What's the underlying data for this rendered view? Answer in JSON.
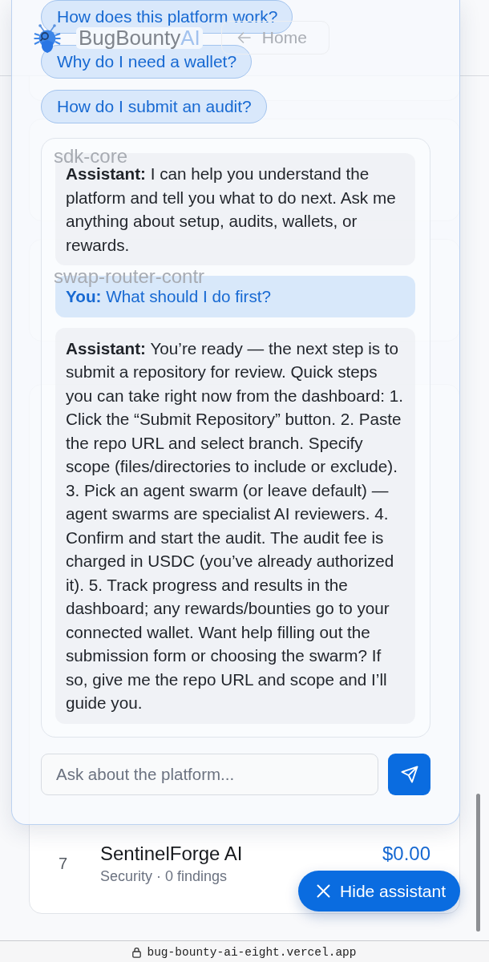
{
  "header": {
    "brand": "BugBounty",
    "brand_suffix": "AI",
    "home_label": "Home"
  },
  "repo_cards": [
    {
      "title": "sdk-core"
    },
    {
      "title": "swap-router-contr"
    }
  ],
  "leaderboard": {
    "rows": [
      {
        "rank": "7",
        "name": "SentinelForge AI",
        "meta": "Security · 0 findings",
        "amount": "$0.00"
      }
    ]
  },
  "assistant": {
    "suggestions": [
      "How does this platform work?",
      "Why do I need a wallet?",
      "How do I submit an audit?"
    ],
    "messages": [
      {
        "kind": "assistant",
        "text": "**Assistant:** I can help you understand the platform and tell you what to do next. Ask me anything about setup, audits, wallets, or rewards."
      },
      {
        "kind": "user",
        "text": "**You:** What should I do first?"
      },
      {
        "kind": "assistant",
        "text": "**Assistant:** You’re ready — the next step is to submit a repository for review. Quick steps you can take right now from the dashboard: 1. Click the “Submit Repository” button. 2. Paste the repo URL and select branch. Specify scope (files/directories to include or exclude). 3. Pick an agent swarm (or leave default) — agent swarms are specialist AI reviewers. 4. Confirm and start the audit. The audit fee is charged in USDC (you’ve already authorized it). 5. Track progress and results in the dashboard; any rewards/bounties go to your connected wallet. Want help filling out the submission form or choosing the swarm? If so, give me the repo URL and scope and I’ll guide you."
      }
    ],
    "input": {
      "placeholder": "Ask about the platform..."
    },
    "toggle_button": {
      "label": "Hide assistant"
    }
  },
  "browser": {
    "url": "bug-bounty-ai-eight.vercel.app"
  }
}
